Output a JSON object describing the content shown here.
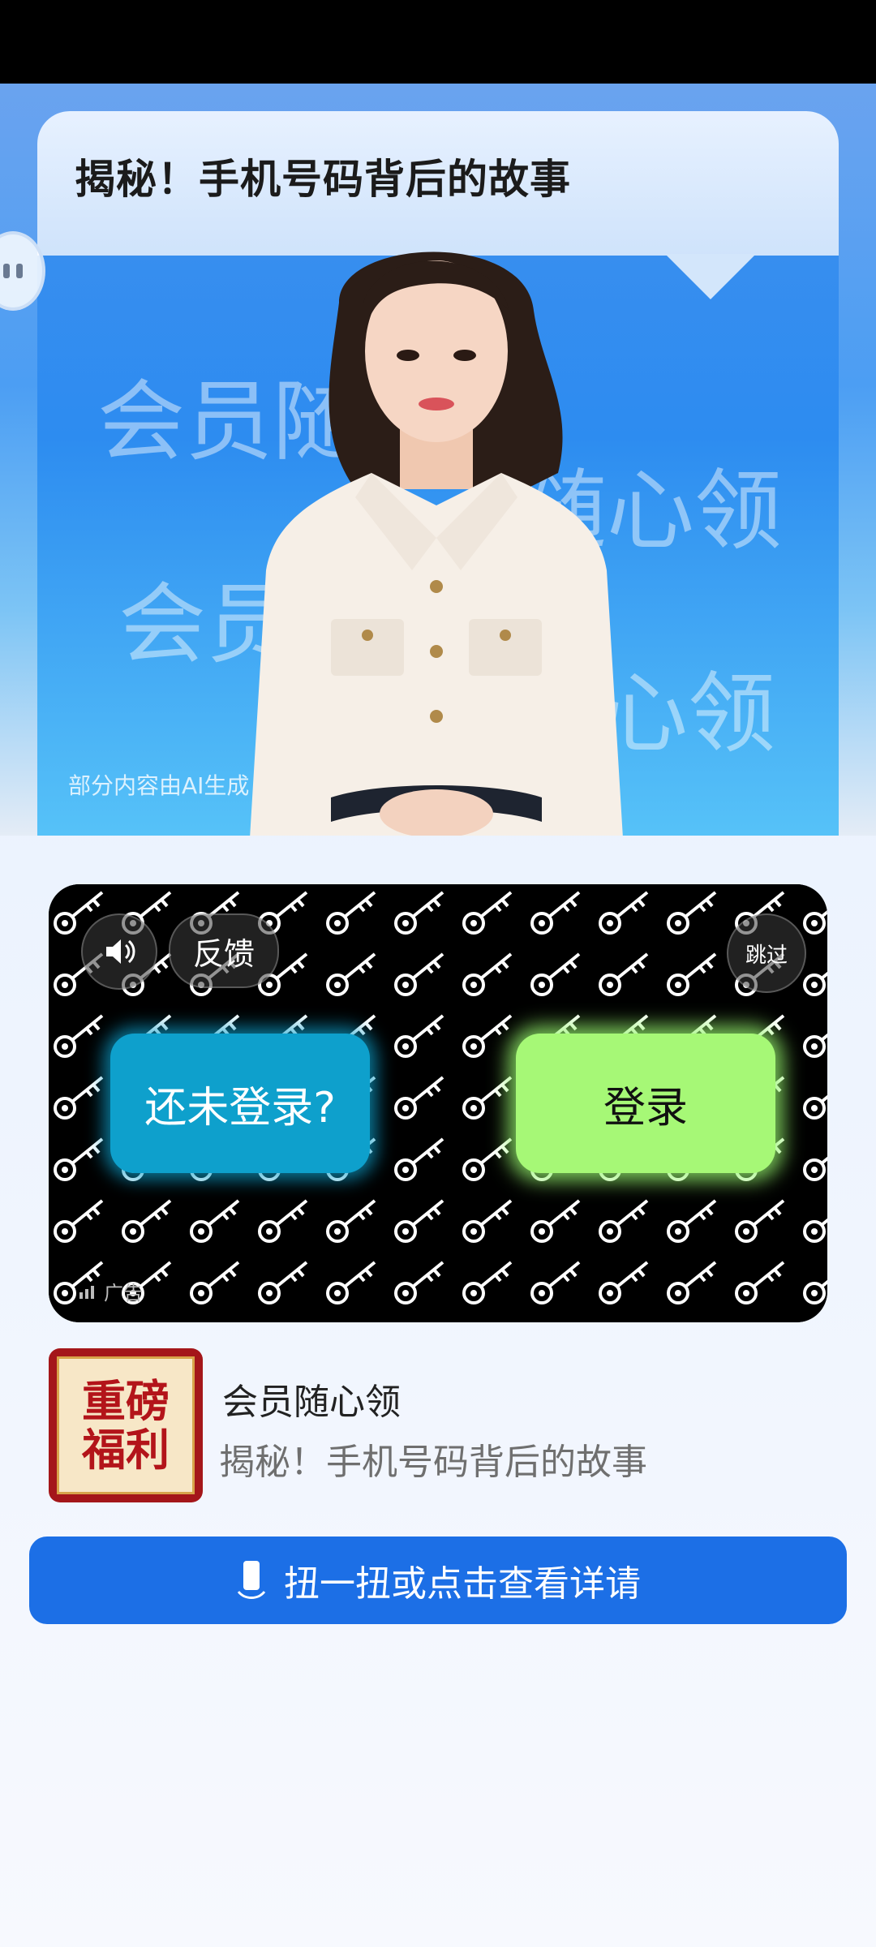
{
  "video": {
    "title": "揭秘！手机号码背后的故事",
    "bg_texts": [
      "会员随心",
      "随心领",
      "会员",
      "心领"
    ],
    "ai_note": "部分内容由AI生成"
  },
  "ad": {
    "feedback_label": "反馈",
    "skip_label": "跳过",
    "not_logged_in_label": "还未登录?",
    "login_label": "登录",
    "ad_tag": "广告"
  },
  "app": {
    "icon_text_line1": "重磅",
    "icon_text_line2": "福利",
    "name": "会员随心领",
    "description": "揭秘！手机号码背后的故事"
  },
  "cta": {
    "label": "扭一扭或点击查看详请"
  },
  "colors": {
    "cta_blue": "#1c6fe6",
    "login_green": "#a6f876",
    "not_login_blue": "#0ea0cc"
  }
}
